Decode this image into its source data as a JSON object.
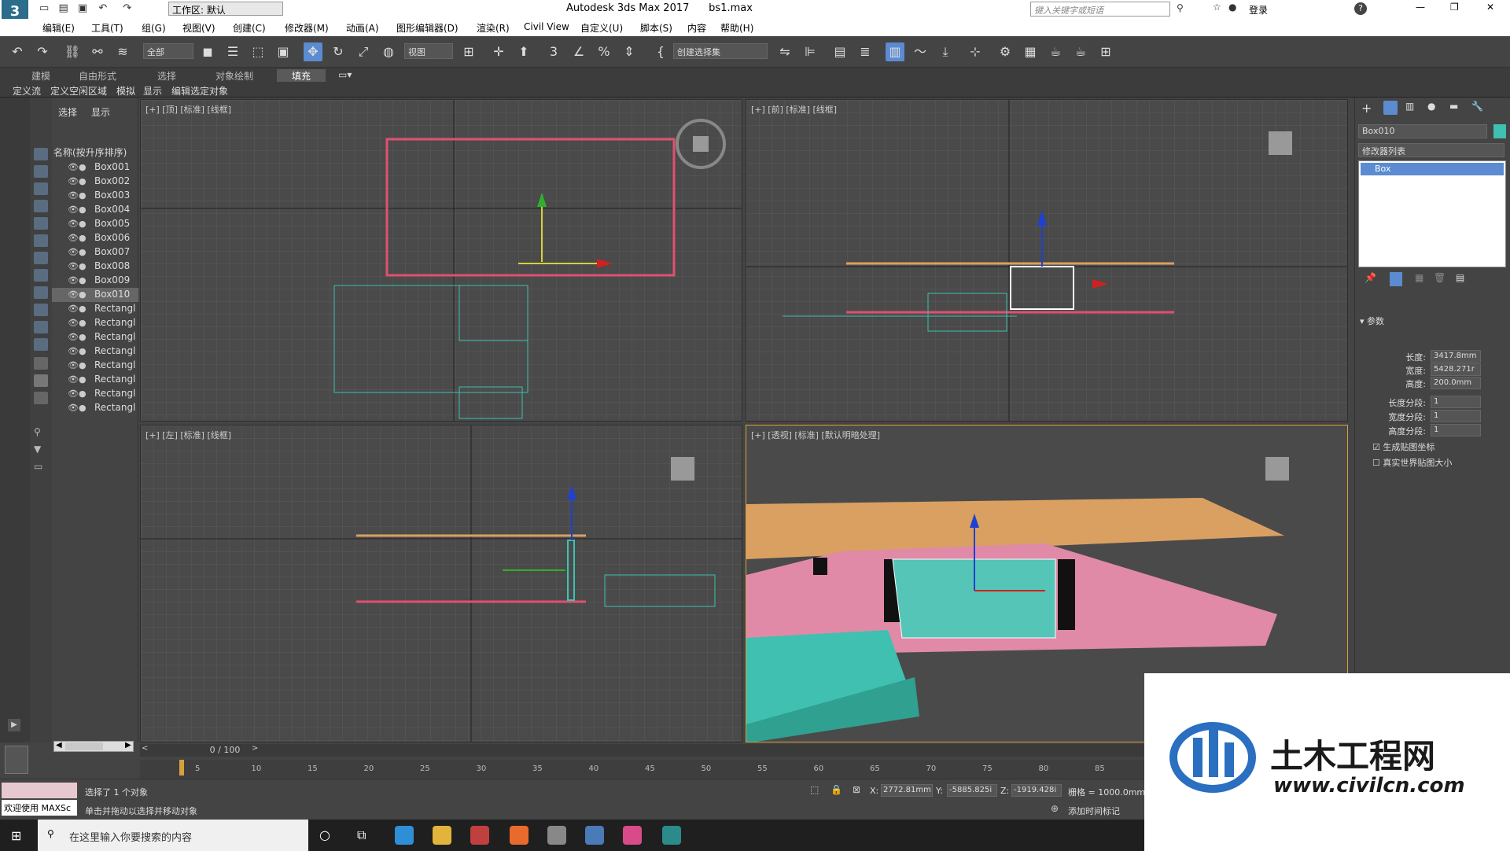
{
  "window": {
    "title": "Autodesk 3ds Max 2017      bs1.max",
    "workspace_label": "工作区: 默认",
    "search_placeholder": "键入关键字或短语",
    "login": "登录"
  },
  "menu": [
    "编辑(E)",
    "工具(T)",
    "组(G)",
    "视图(V)",
    "创建(C)",
    "修改器(M)",
    "动画(A)",
    "图形编辑器(D)",
    "渲染(R)",
    "Civil View",
    "自定义(U)",
    "脚本(S)",
    "内容",
    "帮助(H)"
  ],
  "toolbar": {
    "filter_label": "全部",
    "refcoord_label": "视图",
    "selection_set_label": "创建选择集"
  },
  "ribbon_tabs": [
    "建模",
    "自由形式",
    "选择",
    "对象绘制",
    "填充"
  ],
  "sub_ribbon": [
    "定义流",
    "定义空闲区域",
    "模拟",
    "显示",
    "编辑选定对象"
  ],
  "scene_explorer": {
    "tabs": [
      "选择",
      "显示"
    ],
    "header": "名称(按升序排序)",
    "items": [
      "Box001",
      "Box002",
      "Box003",
      "Box004",
      "Box005",
      "Box006",
      "Box007",
      "Box008",
      "Box009",
      "Box010",
      "Rectangl",
      "Rectangl",
      "Rectangl",
      "Rectangl",
      "Rectangl",
      "Rectangl",
      "Rectangl",
      "Rectangl"
    ],
    "selected": "Box010"
  },
  "viewports": {
    "top": "[+] [顶] [标准] [线框]",
    "front": "[+] [前] [标准] [线框]",
    "left": "[+] [左] [标准] [线框]",
    "persp": "[+] [透视] [标准] [默认明暗处理]"
  },
  "command_panel": {
    "object_name": "Box010",
    "modifier_list": "修改器列表",
    "stack_item": "Box",
    "params_header": "参数",
    "params": [
      {
        "label": "长度:",
        "value": "3417.8mm"
      },
      {
        "label": "宽度:",
        "value": "5428.271r"
      },
      {
        "label": "高度:",
        "value": "200.0mm"
      },
      {
        "label": "长度分段:",
        "value": "1"
      },
      {
        "label": "宽度分段:",
        "value": "1"
      },
      {
        "label": "高度分段:",
        "value": "1"
      }
    ],
    "check_gen_uv": "生成贴图坐标",
    "check_real_world": "真实世界贴图大小"
  },
  "timeline": {
    "frame": "0 / 100",
    "ticks": [
      "5",
      "10",
      "15",
      "20",
      "25",
      "30",
      "35",
      "40",
      "45",
      "50",
      "55",
      "60",
      "65",
      "70",
      "75",
      "80",
      "85"
    ]
  },
  "status": {
    "selected_text": "选择了 1 个对象",
    "hint_text": "单击并拖动以选择并移动对象",
    "welcome": "欢迎使用 MAXSc",
    "x_value": "2772.81mm",
    "y_value": "-5885.825i",
    "z_value": "-1919.428i",
    "grid_text": "栅格 = 1000.0mm",
    "add_time_tag": "添加时间标记",
    "x_label": "X:",
    "y_label": "Y:",
    "z_label": "Z:"
  },
  "taskbar": {
    "search_placeholder": "在这里输入你要搜索的内容"
  },
  "watermark": {
    "brand_cn": "土木工程网",
    "url": "www.civilcn.com"
  },
  "colors": {
    "accent_blue": "#5b8bd0",
    "selection_pink": "#e05070",
    "teal": "#3fc0b0",
    "orange_top": "#d9a062",
    "pink_floor": "#e08aa8"
  }
}
